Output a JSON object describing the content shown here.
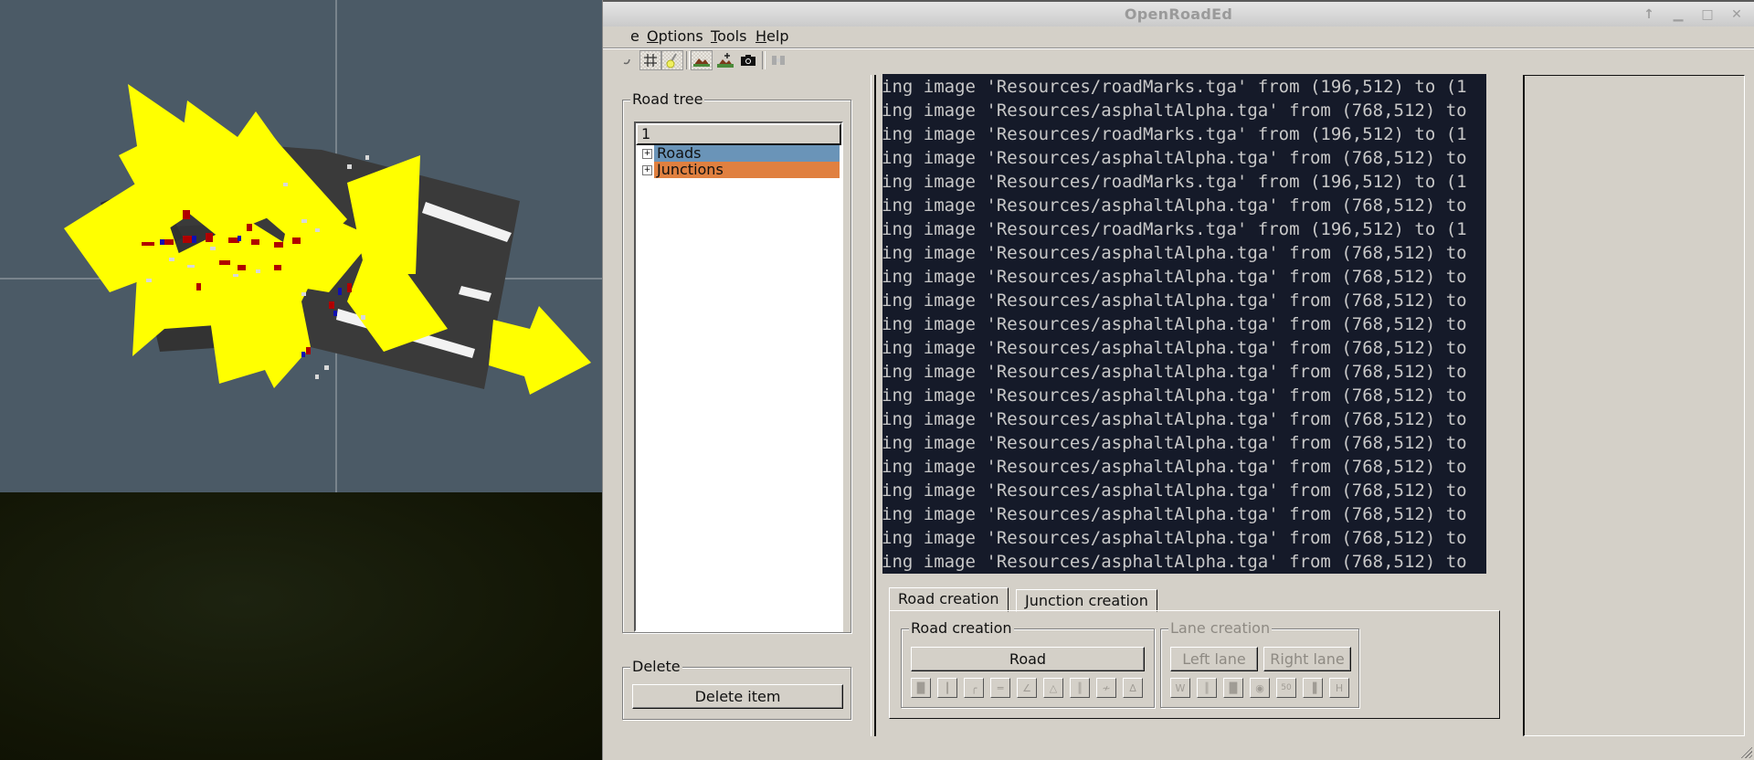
{
  "window": {
    "title": "OpenRoadEd",
    "controls": [
      "keep-above",
      "minimize",
      "maximize",
      "close"
    ]
  },
  "menubar": {
    "items": [
      {
        "label": "e",
        "full_label": "File",
        "mnemonic_index": -1
      },
      {
        "label": "Options",
        "mnemonic": "O"
      },
      {
        "label": "Tools",
        "mnemonic": "T"
      },
      {
        "label": "Help",
        "mnemonic": "H"
      }
    ]
  },
  "toolbar": {
    "items": [
      {
        "icon": "partially-hidden-tool-icon",
        "pressed": false
      },
      {
        "icon": "grid-icon",
        "pressed": true
      },
      {
        "icon": "pin-icon",
        "pressed": true
      },
      {
        "icon": "terrain-icon",
        "pressed": true
      },
      {
        "icon": "add-terrain-icon",
        "pressed": false
      },
      {
        "icon": "camera-icon",
        "pressed": false
      },
      {
        "icon": "record-icon",
        "pressed": false,
        "disabled": true
      }
    ]
  },
  "road_tree": {
    "title": "Road tree",
    "header": "1",
    "items": [
      {
        "label": "Roads",
        "color": "#6a94b8"
      },
      {
        "label": "Junctions",
        "color": "#e08040"
      }
    ]
  },
  "delete_group": {
    "title": "Delete",
    "button": "Delete item"
  },
  "console": {
    "lines": [
      "ing image 'Resources/roadMarks.tga' from (196,512) to (1",
      "ing image 'Resources/asphaltAlpha.tga' from (768,512) to",
      "ing image 'Resources/roadMarks.tga' from (196,512) to (1",
      "ing image 'Resources/asphaltAlpha.tga' from (768,512) to",
      "ing image 'Resources/roadMarks.tga' from (196,512) to (1",
      "ing image 'Resources/asphaltAlpha.tga' from (768,512) to",
      "ing image 'Resources/roadMarks.tga' from (196,512) to (1",
      "ing image 'Resources/asphaltAlpha.tga' from (768,512) to",
      "ing image 'Resources/asphaltAlpha.tga' from (768,512) to",
      "ing image 'Resources/asphaltAlpha.tga' from (768,512) to",
      "ing image 'Resources/asphaltAlpha.tga' from (768,512) to",
      "ing image 'Resources/asphaltAlpha.tga' from (768,512) to",
      "ing image 'Resources/asphaltAlpha.tga' from (768,512) to",
      "ing image 'Resources/asphaltAlpha.tga' from (768,512) to",
      "ing image 'Resources/asphaltAlpha.tga' from (768,512) to",
      "ing image 'Resources/asphaltAlpha.tga' from (768,512) to",
      "ing image 'Resources/asphaltAlpha.tga' from (768,512) to",
      "ing image 'Resources/asphaltAlpha.tga' from (768,512) to",
      "ing image 'Resources/asphaltAlpha.tga' from (768,512) to",
      "ing image 'Resources/asphaltAlpha.tga' from (768,512) to",
      "ing image 'Resources/asphaltAlpha.tga' from (768,512) to",
      "ing image 'Resources/asphaltAlpha.tga' from (768,512) to",
      "ing image 'Resources/asphaltAlpha.tga' from (768,512) to"
    ]
  },
  "tabs": {
    "items": [
      {
        "label": "Road creation",
        "active": true
      },
      {
        "label": "Junction creation",
        "active": false
      }
    ]
  },
  "road_creation": {
    "title": "Road creation",
    "road_button": "Road",
    "tools": [
      "line-icon",
      "line-icon",
      "arc-icon",
      "straight-icon",
      "slope-icon",
      "elevation-icon",
      "lanes-icon",
      "spiral-icon",
      "superelevation-icon"
    ]
  },
  "lane_creation": {
    "title": "Lane creation",
    "left_lane": "Left lane",
    "right_lane": "Right lane",
    "tools": [
      {
        "icon": "width-icon",
        "glyph": "W"
      },
      {
        "icon": "lane-mark-icon",
        "glyph": ""
      },
      {
        "icon": "lane-material-icon",
        "glyph": ""
      },
      {
        "icon": "visibility-icon",
        "glyph": ""
      },
      {
        "icon": "speed-icon",
        "glyph": "50"
      },
      {
        "icon": "access-icon",
        "glyph": ""
      },
      {
        "icon": "height-icon",
        "glyph": "H"
      }
    ]
  },
  "viewport": {
    "background": "#4b5a66",
    "arrow_color": "#ffff00",
    "road_color": "#3a3a3a"
  }
}
